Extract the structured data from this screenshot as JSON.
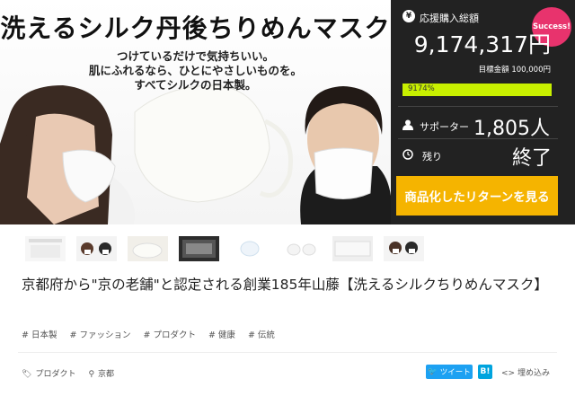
{
  "hero": {
    "title": "洗えるシルク丹後ちりめんマスク",
    "subtitle_lines": [
      "つけているだけで気持ちいい。",
      "肌にふれるなら、ひとにやさしいものを。",
      "すべてシルクの日本製。"
    ]
  },
  "panel": {
    "badge": "Success!",
    "support_label": "応援購入総額",
    "amount": "9,174,317円",
    "goal": "目標金額 100,000円",
    "progress_text": "9174%",
    "progress_fraction": 1.0,
    "supporters_label": "サポーター",
    "supporters_value": "1,805人",
    "remaining_label": "残り",
    "remaining_value": "終了",
    "cta_label": "商品化したリターンを見る",
    "colors": {
      "panel_bg": "#222222",
      "badge": "#e8336d",
      "progress": "#c8f000",
      "cta": "#f5b400"
    }
  },
  "thumbnails": [
    "thumb-1",
    "thumb-2",
    "thumb-3",
    "thumb-4",
    "thumb-5",
    "thumb-6",
    "thumb-7",
    "thumb-8"
  ],
  "project_title": "京都府から\"京の老舗\"と認定される創業185年山藤【洗えるシルクちりめんマスク】",
  "tags": [
    "# 日本製",
    "# ファッション",
    "# プロダクト",
    "# 健康",
    "# 伝統"
  ],
  "footer": {
    "category": "プロダクト",
    "location": "京都",
    "tweet": "ツイート",
    "hatena": "B!",
    "embed": "埋め込み"
  }
}
